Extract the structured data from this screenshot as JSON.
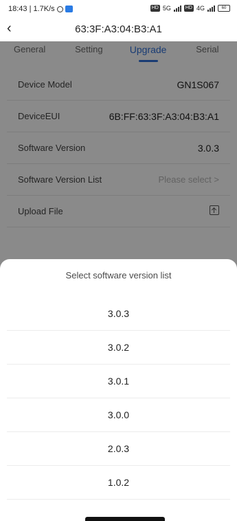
{
  "status_bar": {
    "time_speed": "18:43 | 1.7K/s",
    "net1": "5G",
    "net2": "4G",
    "hd": "HD",
    "battery": "60"
  },
  "header": {
    "title": "63:3F:A3:04:B3:A1"
  },
  "tabs": [
    {
      "label": "General",
      "active": false
    },
    {
      "label": "Setting",
      "active": false
    },
    {
      "label": "Upgrade",
      "active": true
    },
    {
      "label": "Serial",
      "active": false
    }
  ],
  "fields": {
    "device_model": {
      "label": "Device Model",
      "value": "GN1S067"
    },
    "device_eui": {
      "label": "DeviceEUI",
      "value": "6B:FF:63:3F:A3:04:B3:A1"
    },
    "software_version": {
      "label": "Software Version",
      "value": "3.0.3"
    },
    "software_version_list": {
      "label": "Software Version List",
      "placeholder": "Please select >"
    },
    "upload_file": {
      "label": "Upload File"
    }
  },
  "sheet": {
    "title": "Select software version list",
    "options": [
      "3.0.3",
      "3.0.2",
      "3.0.1",
      "3.0.0",
      "2.0.3",
      "1.0.2"
    ]
  },
  "colors": {
    "accent": "#2f6fd6",
    "overlay": "rgba(0,0,0,0.46)"
  }
}
